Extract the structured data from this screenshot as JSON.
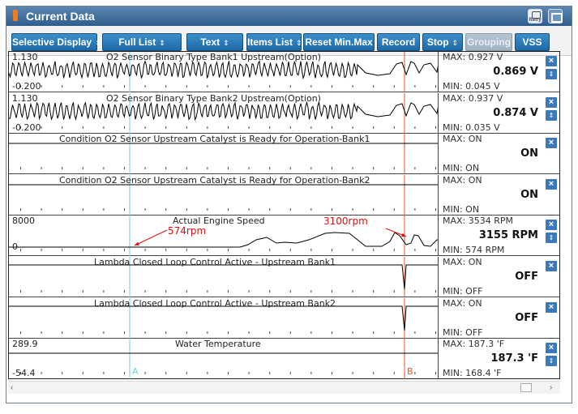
{
  "window": {
    "title": "Current Data",
    "retry_label": "Retry"
  },
  "toolbar": [
    {
      "label": "Selective Display",
      "arrow": "⇕",
      "disabled": false
    },
    {
      "label": "Full List",
      "arrow": "⇕",
      "disabled": false
    },
    {
      "label": "Text",
      "arrow": "⇕",
      "disabled": false
    },
    {
      "label": "Items List",
      "arrow": "⇕",
      "disabled": false
    },
    {
      "label": "Reset Min.Max",
      "arrow": "",
      "disabled": false
    },
    {
      "label": "Record",
      "arrow": "",
      "disabled": false
    },
    {
      "label": "Stop",
      "arrow": "⇕",
      "disabled": false
    },
    {
      "label": "Grouping",
      "arrow": "",
      "disabled": true
    },
    {
      "label": "VSS",
      "arrow": "",
      "disabled": false
    }
  ],
  "rows": [
    {
      "title": "O2 Sensor Binary Type Bank1 Upstream(Option)",
      "ymax": "1.130",
      "ymin": "-0.200",
      "max": "MAX: 0.927 V",
      "value": "0.869 V",
      "min": "MIN: 0.045 V",
      "has_arrow": true,
      "trace": "o2"
    },
    {
      "title": "O2 Sensor Binary Type Bank2 Upstream(Option)",
      "ymax": "1.130",
      "ymin": "-0.200",
      "max": "MAX: 0.937 V",
      "value": "0.874 V",
      "min": "MIN: 0.035 V",
      "has_arrow": true,
      "trace": "o2b"
    },
    {
      "title": "Condition O2 Sensor Upstream Catalyst is Ready for Operation-Bank1",
      "ymax": "",
      "ymin": "",
      "max": "MAX: ON",
      "value": "ON",
      "min": "MIN: ON",
      "has_arrow": false,
      "trace": "flat_high"
    },
    {
      "title": "Condition O2 Sensor Upstream Catalyst is Ready for Operation-Bank2",
      "ymax": "",
      "ymin": "",
      "max": "MAX: ON",
      "value": "ON",
      "min": "MIN: ON",
      "has_arrow": false,
      "trace": "flat_high"
    },
    {
      "title": "Actual Engine Speed",
      "ymax": "8000",
      "ymin": "0",
      "max": "MAX:  3534 RPM",
      "value": "3155 RPM",
      "min": "MIN:   574 RPM",
      "has_arrow": true,
      "trace": "rpm"
    },
    {
      "title": "Lambda Closed Loop Control Active - Upstream Bank1",
      "ymax": "",
      "ymin": "",
      "max": "MAX: ON",
      "value": "OFF",
      "min": "MIN: OFF",
      "has_arrow": false,
      "trace": "lambda"
    },
    {
      "title": "Lambda Closed Loop Control Active - Upstream Bank2",
      "ymax": "",
      "ymin": "",
      "max": "MAX: ON",
      "value": "OFF",
      "min": "MIN: OFF",
      "has_arrow": false,
      "trace": "lambda"
    },
    {
      "title": "Water Temperature",
      "ymax": "289.9",
      "ymin": "-54.4",
      "max": "MAX: 187.3 'F",
      "value": "187.3 'F",
      "min": "MIN: 168.4 'F",
      "has_arrow": true,
      "trace": "temp"
    }
  ],
  "annotations": {
    "a_label": "574rpm",
    "b_label": "3100rpm"
  },
  "cursors": {
    "a": "A",
    "b": "B",
    "a_color": "#6fd3df",
    "b_color": "#e8551e"
  },
  "colors": {
    "accent": "#1d6aa8",
    "trace": "#000000",
    "annotation": "#e01010"
  }
}
